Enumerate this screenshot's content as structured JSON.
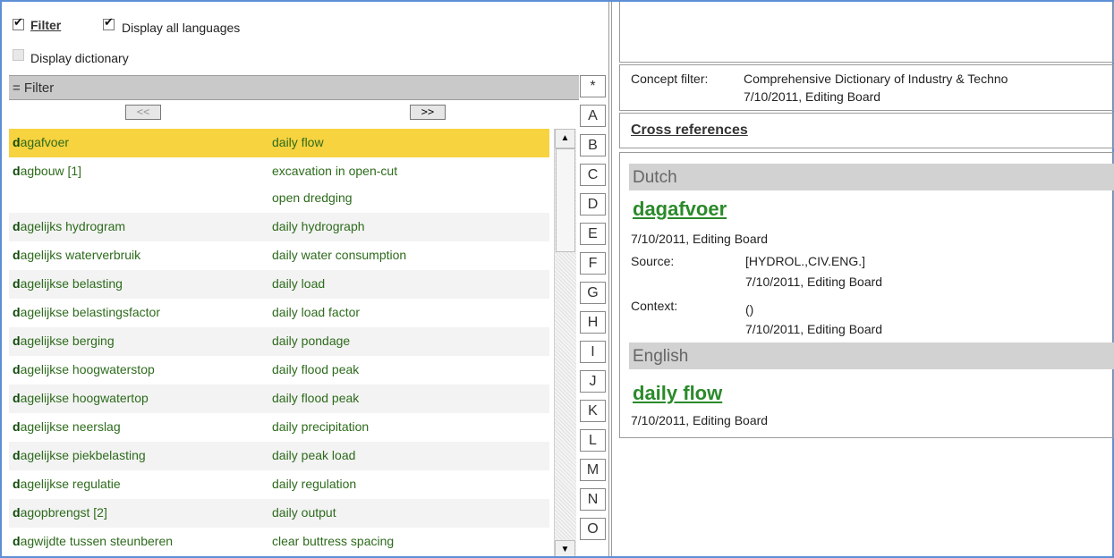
{
  "options": {
    "filter_label": "Filter",
    "display_all_languages_label": "Display all languages",
    "display_dictionary_label": "Display dictionary"
  },
  "filter_bar": {
    "label": "= Filter"
  },
  "nav": {
    "prev": "<<",
    "next": ">>"
  },
  "list": [
    {
      "first": "d",
      "rest": "agafvoer",
      "target": "daily flow"
    },
    {
      "first": "d",
      "rest": "agbouw [1]",
      "target": "excavation in open-cut",
      "target2": "open dredging"
    },
    {
      "first": "d",
      "rest": "agelijks hydrogram",
      "target": "daily hydrograph"
    },
    {
      "first": "d",
      "rest": "agelijks waterverbruik",
      "target": "daily water consumption"
    },
    {
      "first": "d",
      "rest": "agelijkse belasting",
      "target": "daily load"
    },
    {
      "first": "d",
      "rest": "agelijkse belastingsfactor",
      "target": "daily load factor"
    },
    {
      "first": "d",
      "rest": "agelijkse berging",
      "target": "daily pondage"
    },
    {
      "first": "d",
      "rest": "agelijkse hoogwaterstop",
      "target": "daily flood peak"
    },
    {
      "first": "d",
      "rest": "agelijkse hoogwatertop",
      "target": "daily flood peak"
    },
    {
      "first": "d",
      "rest": "agelijkse neerslag",
      "target": "daily precipitation"
    },
    {
      "first": "d",
      "rest": "agelijkse piekbelasting",
      "target": "daily peak load"
    },
    {
      "first": "d",
      "rest": "agelijkse regulatie",
      "target": "daily regulation"
    },
    {
      "first": "d",
      "rest": "agopbrengst [2]",
      "target": "daily output"
    },
    {
      "first": "d",
      "rest": "agwijdte tussen steunberen",
      "target": "clear buttress spacing"
    }
  ],
  "letters": [
    "*",
    "A",
    "B",
    "C",
    "D",
    "E",
    "F",
    "G",
    "H",
    "I",
    "J",
    "K",
    "L",
    "M",
    "N",
    "O"
  ],
  "scroll": {
    "up": "▲",
    "down": "▼"
  },
  "concept": {
    "label": "Concept filter:",
    "value": "Comprehensive Dictionary of Industry & Techno",
    "meta": "7/10/2011, Editing Board"
  },
  "cross_references": "Cross references",
  "dutch": {
    "language": "Dutch",
    "term": "dagafvoer",
    "meta": "7/10/2011, Editing Board",
    "source_label": "Source:",
    "source_value": "[HYDROL.,CIV.ENG.]",
    "source_meta": "7/10/2011, Editing Board",
    "context_label": "Context:",
    "context_value": "()",
    "context_meta": "7/10/2011, Editing Board"
  },
  "english": {
    "language": "English",
    "term": "daily flow",
    "meta": "7/10/2011, Editing Board"
  },
  "colors": {
    "selected_row": "#f7d33f",
    "term_green": "#2a8a2a",
    "frame_blue": "#5d8fd6"
  }
}
